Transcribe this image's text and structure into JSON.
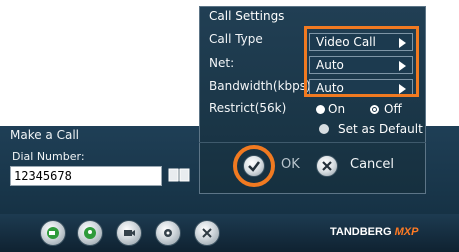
{
  "background": {
    "panel_title": "Make a Call",
    "dial_label": "Dial Number:",
    "dial_value": "12345678",
    "brand_main": "TANDBERG",
    "brand_sub": "MXP"
  },
  "dialog": {
    "title": "Call Settings",
    "call_type_label": "Call Type",
    "call_type_value": "Video Call",
    "net_label": "Net:",
    "net_value": "Auto",
    "bandwidth_label": "Bandwidth(kbps)",
    "bandwidth_value": "Auto",
    "restrict_label": "Restrict(56k)",
    "restrict_on": "On",
    "restrict_off": "Off",
    "restrict_selected": "Off",
    "set_default_label": "Set as Default",
    "ok_label": "OK",
    "cancel_label": "Cancel"
  },
  "colors": {
    "highlight": "#f17a21",
    "panel": "#1b3648"
  },
  "toolbar_icons": [
    "call-icon",
    "contacts-icon",
    "camera-icon",
    "settings-icon",
    "close-icon"
  ]
}
